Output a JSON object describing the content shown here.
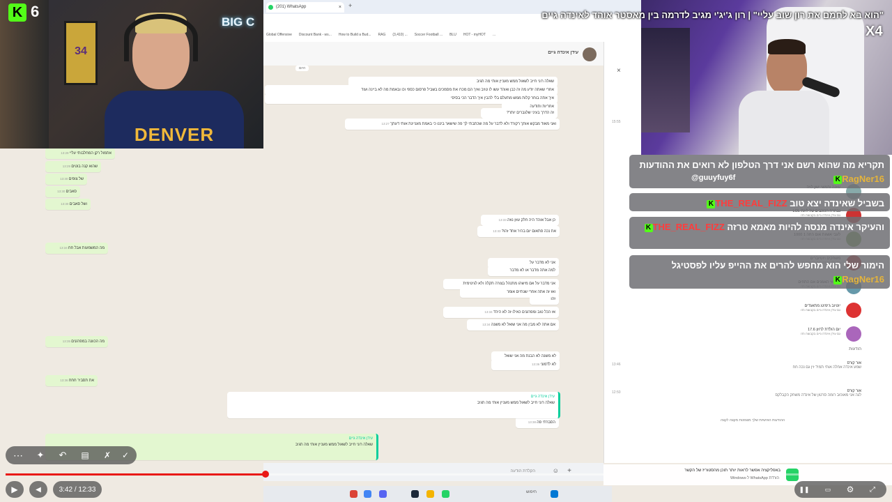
{
  "kick": {
    "channel_number": "6",
    "logo_letter": "K",
    "watermark": "X4"
  },
  "video": {
    "title": "\"הוא בא לחמם את רון שוב עליי\" | רון ג'יג'י מגיב לדרמה בין מאסטר אוהד לאינדה גיים",
    "time": "3:42 / 12:33",
    "progress_fraction": 0.295
  },
  "webcam_left": {
    "shirt_text": "DENVER",
    "neon_sign": "BIG C",
    "jersey_number": "34"
  },
  "whatsapp": {
    "tab_title": "(201) WhatsApp",
    "bookmarks": [
      "Global Offensive",
      "Discount Bank - ws...",
      "How to Build a Bud...",
      "RAG",
      "(3,410) ...",
      "Soccer Football ...",
      "BLU",
      "HOT - myHOT",
      "..."
    ],
    "contact_name": "עידן אינדה גיים",
    "day_label": "היום",
    "input_placeholder": "הקלדת הודעה",
    "bottom_bar_text": "באפליקציה אפשר לראות יותר תוכן מהסטוריז של הקשר",
    "bottom_bar_sub": "הורדת WhatsApp ל-Windows",
    "messages": [
      {
        "text": "שאלה רוני חייב לשאול ממש מעניין אותי מה תגיב",
        "dir": "in"
      },
      {
        "text": "אחרי שאתה יודע מה זה כבן ואוהד עשו לו טויב ואיך הם מכרו את מסמכים בשביל פרסום כספי וכו ובאמת מה לא ביינה ועוד",
        "dir": "in"
      },
      {
        "text": "איך אתה בוחר קלות ממש מתעלם בלי להבין איך הדבר הכי בסיסי",
        "dir": "in"
      },
      {
        "text": "אחריות ותודעה",
        "dir": "in"
      },
      {
        "text": "זה הדרך בעיני שלגברים יותר?",
        "dir": "in"
      },
      {
        "text": "ואני מאוד מבקש אותך רקורד ולא לדבר על מה שכתבתי לך פה שישאר ביננו כי באמת מעניינת אותי דעתך",
        "dir": "in",
        "time": "13:27"
      },
      {
        "text": "אתמול רקן המחלבותי עליי",
        "dir": "out",
        "time": "13:29"
      },
      {
        "text": "שהוא קנה בוטים",
        "dir": "out",
        "time": "13:29"
      },
      {
        "text": "של צופים",
        "dir": "out",
        "time": "13:30"
      },
      {
        "text": "סאבים",
        "dir": "out",
        "time": "13:30"
      },
      {
        "text": "ושל סאבים",
        "dir": "out",
        "time": "13:30"
      },
      {
        "text": "כן אבל אוהד היה חלק עוזן נוזה",
        "dir": "in",
        "time": "13:33"
      },
      {
        "text": "את נכה פתאום יום בהיר אחד זהו?",
        "dir": "in",
        "time": "13:33"
      },
      {
        "text": "מה המשמעות אבל חח",
        "dir": "out",
        "time": "13:34"
      },
      {
        "text": "אני לא מדבר על",
        "dir": "in"
      },
      {
        "text": "למה אתה מדבר או לא מדבר",
        "dir": "in"
      },
      {
        "text": "אני מדבר על אם מישהו מתנהל בצורה תקלה ולא לגיטימית",
        "dir": "in"
      },
      {
        "text": "ואז זה אתה אחרי שנתיים אומר",
        "dir": "in"
      },
      {
        "text": "זהו",
        "dir": "in"
      },
      {
        "text": "אז הכל טוב ומפרגנים כאילו זה לא היה?",
        "dir": "in",
        "time": "13:34"
      },
      {
        "text": "אם אתה לא מבין מה אני שואל לא משנה",
        "dir": "in",
        "time": "13:34"
      },
      {
        "text": "מה הכוונה במפרגנים",
        "dir": "out",
        "time": "13:35"
      },
      {
        "text": "לא משנה לא הבנת מה אני שואל",
        "dir": "in"
      },
      {
        "text": "לא לדמוני",
        "dir": "in",
        "time": "13:36"
      },
      {
        "text": "את תסביר חחח",
        "dir": "out",
        "time": "13:36"
      },
      {
        "text": "הסברתי פה",
        "dir": "in",
        "time": "13:38"
      }
    ],
    "updates": [
      {
        "name": "עוזנה ותמשי ישון לויה",
        "sub": ""
      },
      {
        "name": "נבחרת הכוכבים של ליגת LOL",
        "sub": "גם עידן אינדה גיים בקבוצה הזו"
      },
      {
        "name": "לעבי אשוות אום החה 1 1000",
        "sub": "גם עידן אינדה גיים בקבוצה הזו"
      },
      {
        "name": "משחקים ויוטיוברים",
        "sub": "גם עידן אינדה גיים בקבוצה הזו"
      },
      {
        "name": "נמ כוזי האמנים אם התחים",
        "sub": "גם עידן אינדה גיים בקבוצה הזו"
      },
      {
        "name": "יוטיוב ג'ימינג מתאגדים",
        "sub": "גם עידן אינדה גיים בקבוצה הזו"
      },
      {
        "name": "יום הולדת לרוזן 17.6",
        "sub": "גם עידן אינדה גיים בקבוצה הזו"
      }
    ],
    "notes_header": "הודעות",
    "notes": [
      {
        "name": "אור קורס",
        "text": "שמע אינדה אחלה אותי תמיד זין גם נכה חח",
        "time": "13:46"
      },
      {
        "name": "אור קורס",
        "text": "לגה אני מאוכזב רומה סרטון של אינדה משחק הקבלקס",
        "time": "12:50"
      }
    ],
    "encryption_note": "ההודעות האישיות שלך מוצפנות מקצה לקצה"
  },
  "chat": [
    {
      "user": "RagNer16",
      "user_color": "#e5b43a",
      "text": "תקריא מה שהוא רשם אני דרך הטלפון לא רואים את ההודעות"
    },
    {
      "user": "THE_REAL_FIZZ",
      "user_color": "#ff3c3c",
      "text": "בשביל שאינדה יצא טוב"
    },
    {
      "user": "THE_REAL_FIZZ",
      "user_color": "#ff3c3c",
      "text": "והעיקר אינדה מנסה להיות מאמא טרזה"
    },
    {
      "user": "RagNer16",
      "user_color": "#e5b43a",
      "text": "הימור שלי הוא מחפש להרים את ההייפ עליו לפסטיגל"
    }
  ],
  "chat_mention": "@guuyfuy6f",
  "taskbar": {
    "search_placeholder": "חיפוש"
  },
  "colors": {
    "kick_green": "#53fc18",
    "progress_red": "#e91916",
    "whatsapp_green": "#25d366"
  }
}
